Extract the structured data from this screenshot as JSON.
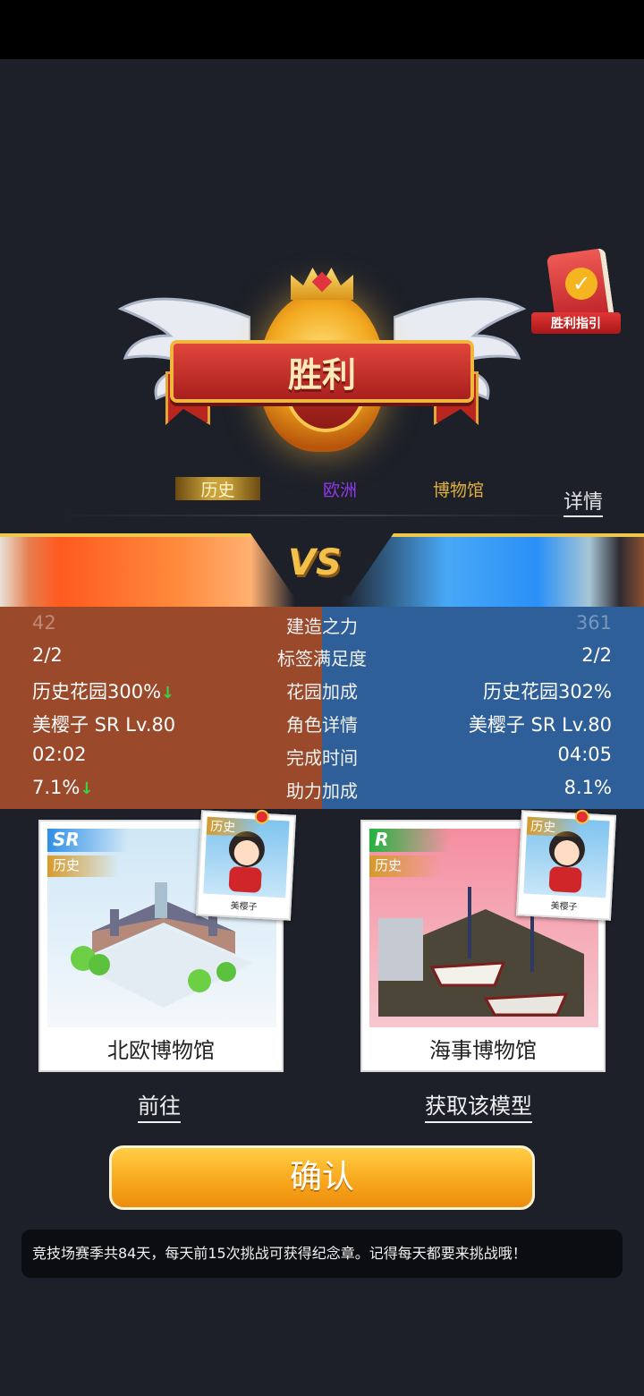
{
  "result": {
    "title": "胜利"
  },
  "guide": {
    "label": "胜利指引"
  },
  "tags": {
    "history": "历史",
    "europe": "欧洲",
    "museum": "博物馆"
  },
  "details_link": "详情",
  "vs_label": "VS",
  "stats": {
    "rows": [
      {
        "left": "42",
        "label": "建造之力",
        "right": "361"
      },
      {
        "left": "2/2",
        "label": "标签满足度",
        "right": "2/2"
      },
      {
        "left": "历史花园300%",
        "label": "花园加成",
        "right": "历史花园302%"
      },
      {
        "left": "美樱子 SR Lv.80",
        "label": "角色详情",
        "right": "美樱子 SR Lv.80"
      },
      {
        "left": "02:02",
        "label": "完成时间",
        "right": "04:05"
      },
      {
        "left": "7.1%",
        "label": "助力加成",
        "right": "8.1%"
      }
    ],
    "down_arrow": "↓"
  },
  "cards": {
    "left": {
      "rarity": "SR",
      "tag": "历史",
      "title": "北欧博物馆"
    },
    "right": {
      "rarity": "R",
      "tag": "历史",
      "title": "海事博物馆"
    }
  },
  "character": {
    "tag": "历史",
    "name": "美樱子"
  },
  "links": {
    "goto": "前往",
    "obtain": "获取该模型"
  },
  "confirm_label": "确认",
  "notice": "竞技场赛季共84天，每天前15次挑战可获得纪念章。记得每天都要来挑战哦！",
  "colors": {
    "accent": "#f7a51a",
    "left_team": "#9a4a2a",
    "right_team": "#2f5f98"
  }
}
